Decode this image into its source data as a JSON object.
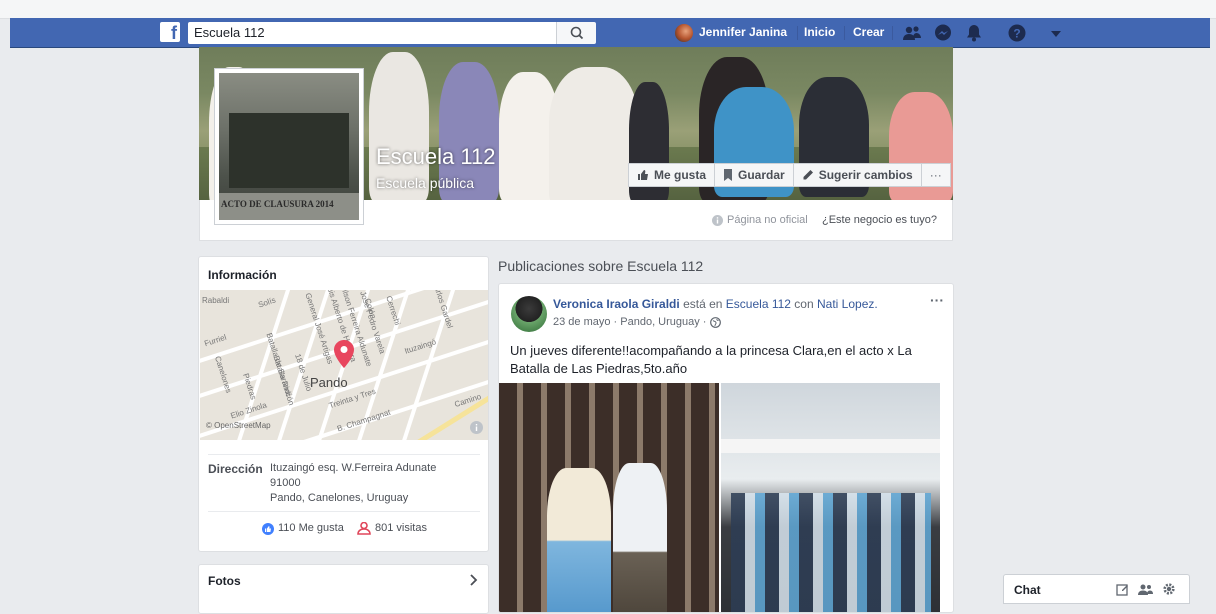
{
  "colors": {
    "brand": "#4267b2",
    "link": "#365899",
    "text": "#1d2129",
    "muted": "#90949c",
    "page_bg": "#e9ebee"
  },
  "topbar": {
    "search_value": "Escuela 112",
    "user_name": "Jennifer Janina",
    "nav_home": "Inicio",
    "nav_create": "Crear"
  },
  "page": {
    "name": "Escuela 112",
    "category": "Escuela pública",
    "profile_text": "ACTO DE CLAUSURA 2014",
    "actions": {
      "like": "Me gusta",
      "save": "Guardar",
      "suggest": "Sugerir cambios",
      "more": "···"
    },
    "unofficial": "Página no oficial",
    "claim": "¿Este negocio es tuyo?"
  },
  "info": {
    "title": "Información",
    "map": {
      "city_label": "Pando",
      "attribution": "© OpenStreetMap",
      "streets": [
        "Rabaldi",
        "Solís",
        "Furriel",
        "General José Artigas",
        "Jose Pedro Varela",
        "Luis Alberto de Herrera",
        "Ituzaingó",
        "Batalla de Sarandí",
        "Canelones",
        "Piedras",
        "Batalla Rincón",
        "18 de Julio",
        "Elio Zinola",
        "Treinta y Tres",
        "B. Champagnat",
        "Camino",
        "Wilson Ferreira Aldunate",
        "Colón",
        "Carlos Gardel",
        "Cerrechi"
      ]
    },
    "address_label": "Dirección",
    "address_lines": [
      "Ituzaingó esq. W.Ferreira Adunate",
      "91000",
      "Pando, Canelones, Uruguay"
    ],
    "likes": "110 Me gusta",
    "visits": "801 visitas"
  },
  "photos": {
    "title": "Fotos"
  },
  "posts_section": {
    "title": "Publicaciones sobre Escuela 112"
  },
  "post": {
    "author": "Veronica Iraola Giraldi",
    "is_at": "está en",
    "place": "Escuela 112",
    "with": "con",
    "tagged": "Nati Lopez.",
    "meta": "23 de mayo · Pando, Uruguay ·",
    "options": "···",
    "text_line1": "Un jueves diferente!!acompañando a la princesa Clara,en el acto x La",
    "text_line2": "Batalla de Las Piedras,5to.año"
  },
  "chat": {
    "label": "Chat"
  }
}
